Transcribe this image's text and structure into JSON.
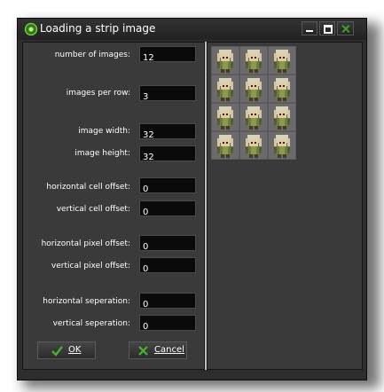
{
  "window": {
    "title": "Loading a strip image",
    "buttons": [
      "minimize",
      "maximize",
      "close"
    ]
  },
  "form": {
    "number_of_images": {
      "label": "number of images:",
      "value": "12"
    },
    "images_per_row": {
      "label": "images per row:",
      "value": "3"
    },
    "image_width": {
      "label": "image width:",
      "value": "32"
    },
    "image_height": {
      "label": "image height:",
      "value": "32"
    },
    "horizontal_cell_offset": {
      "label": "horizontal cell offset:",
      "value": "0"
    },
    "vertical_cell_offset": {
      "label": "vertical cell offset:",
      "value": "0"
    },
    "horizontal_pixel_offset": {
      "label": "horizontal pixel offset:",
      "value": "0"
    },
    "vertical_pixel_offset": {
      "label": "vertical pixel offset:",
      "value": "0"
    },
    "horizontal_seperation": {
      "label": "horizontal seperation:",
      "value": "0"
    },
    "vertical_seperation": {
      "label": "vertical seperation:",
      "value": "0"
    }
  },
  "actions": {
    "ok_label": "OK",
    "cancel_label": "Cancel"
  },
  "preview": {
    "rows": 4,
    "columns": 3,
    "frames": 12
  },
  "colors": {
    "background": "#2d2d2d",
    "panel": "#3a3a3a",
    "accent_green": "#3aa01c",
    "field": "#0a0a0a"
  }
}
